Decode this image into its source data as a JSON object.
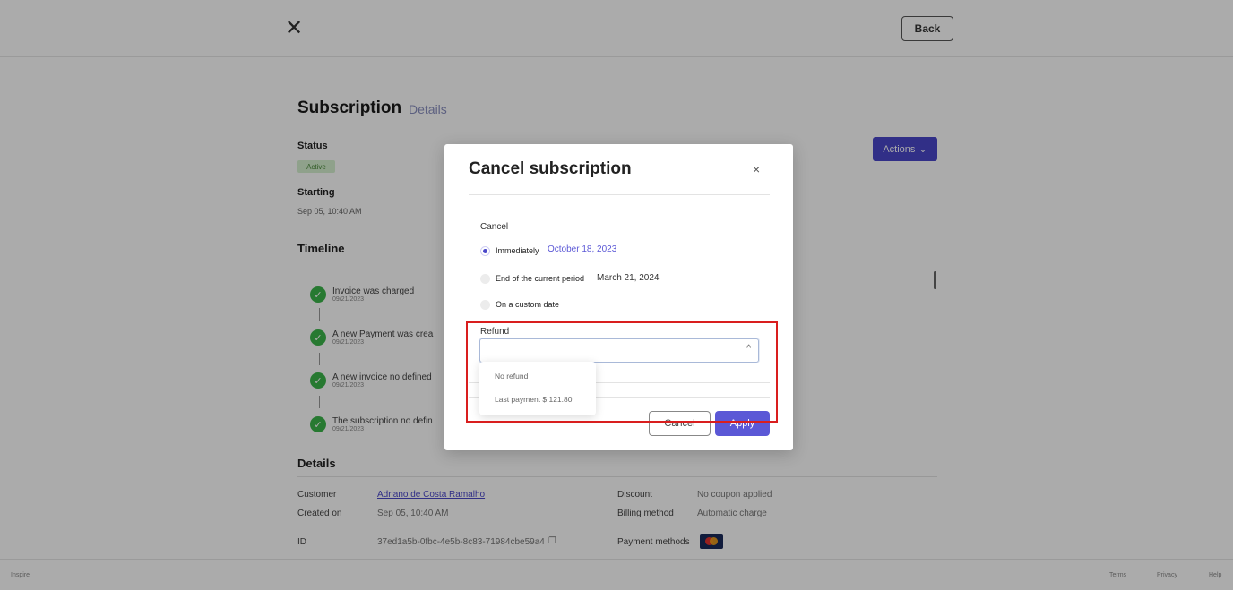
{
  "header": {
    "close_icon": "close-icon",
    "back_label": "Back"
  },
  "page": {
    "title": "Subscription",
    "subtitle": "Details",
    "actions_label": "Actions",
    "actions_chevron": "⌄",
    "status_label": "Status",
    "status_value": "Active",
    "starting_label": "Starting",
    "starting_value": "Sep 05, 10:40 AM"
  },
  "timeline": {
    "title": "Timeline",
    "items": [
      {
        "text": "Invoice was charged",
        "date": "09/21/2023"
      },
      {
        "text": "A new Payment was crea",
        "date": "09/21/2023"
      },
      {
        "text": "A new invoice no defined",
        "date": "09/21/2023"
      },
      {
        "text": "The subscription no defin",
        "date": "09/21/2023"
      }
    ]
  },
  "details": {
    "title": "Details",
    "customer_label": "Customer",
    "customer_value": "Adriano de Costa Ramalho",
    "created_label": "Created on",
    "created_value": "Sep 05, 10:40 AM",
    "id_label": "ID",
    "id_value": "37ed1a5b-0fbc-4e5b-8c83-71984cbe59a4",
    "discount_label": "Discount",
    "discount_value": "No coupon applied",
    "billing_label": "Billing method",
    "billing_value": "Automatic charge",
    "payment_label": "Payment methods"
  },
  "footer": {
    "brand": "Inspire",
    "links": [
      "Terms",
      "Privacy",
      "Help"
    ]
  },
  "modal": {
    "title": "Cancel subscription",
    "close": "×",
    "cancel_section_label": "Cancel",
    "options": [
      {
        "label": "Immediately",
        "date": "October 18, 2023",
        "selected": true
      },
      {
        "label": "End of the current period",
        "date": "March 21, 2024",
        "selected": false
      },
      {
        "label": "On a custom date",
        "date": "",
        "selected": false
      }
    ],
    "refund_label": "Refund",
    "refund_chevron": "^",
    "refund_options": [
      "No refund",
      "Last payment $ 121.80"
    ],
    "cancel_button": "Cancel",
    "apply_button": "Apply"
  },
  "colors": {
    "accent": "#4a47c9",
    "apply": "#5b58d6",
    "highlight": "#d91e1e",
    "success": "#3bb54a"
  }
}
